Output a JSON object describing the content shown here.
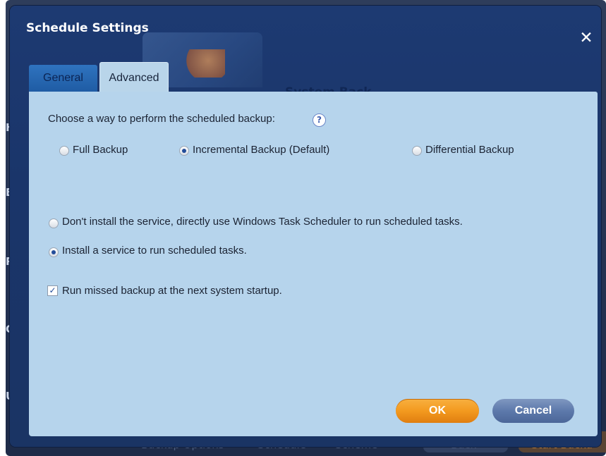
{
  "background": {
    "sidebar_items": [
      "Ho",
      "Ba",
      "Re",
      "Cl",
      "Ut"
    ],
    "bottom_bar": {
      "backup_options": "Backup Options",
      "schedule": "Schedule",
      "scheme": "Scheme",
      "back": "« Back",
      "start": "Start Backu"
    },
    "hidden_heading": "System Back"
  },
  "dialog": {
    "title": "Schedule Settings",
    "close_glyph": "✕",
    "tabs": [
      {
        "label": "General",
        "active": false
      },
      {
        "label": "Advanced",
        "active": true
      }
    ],
    "prompt": "Choose a way to perform the scheduled backup:",
    "help_glyph": "?",
    "backup_types": [
      {
        "label": "Full Backup",
        "selected": false
      },
      {
        "label": "Incremental Backup (Default)",
        "selected": true
      },
      {
        "label": "Differential Backup",
        "selected": false
      }
    ],
    "service_options": [
      {
        "label": "Don't install the service, directly use Windows Task Scheduler to run scheduled tasks.",
        "selected": false
      },
      {
        "label": "Install a service to run scheduled tasks.",
        "selected": true
      }
    ],
    "run_missed": {
      "label": "Run missed backup at the next system startup.",
      "checked": true,
      "glyph": "✓"
    },
    "ok_label": "OK",
    "cancel_label": "Cancel"
  },
  "colors": {
    "panel": "#b6d4ec",
    "dialog": "#1d3a72",
    "ok": "#f39a1f",
    "cancel": "#5d79ab"
  }
}
